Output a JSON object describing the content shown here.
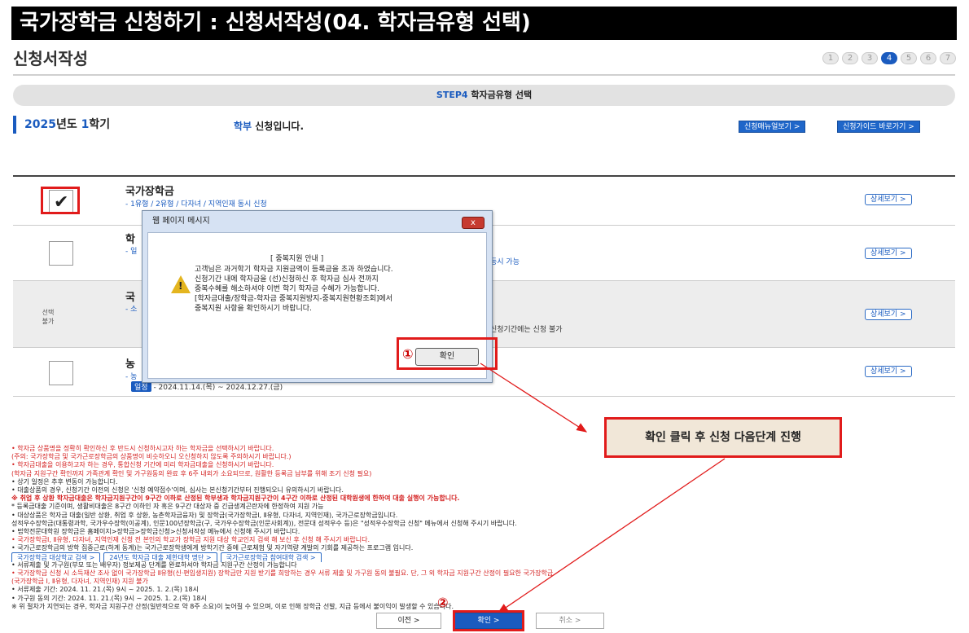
{
  "banner": "국가장학금 신청하기 : 신청서작성(04. 학자금유형 선택)",
  "page_title": "신청서작성",
  "steps": [
    "1",
    "2",
    "3",
    "4",
    "5",
    "6",
    "7"
  ],
  "active_step": "4",
  "step_bar": {
    "step": "STEP4",
    "label": "학자금유형 선택"
  },
  "semester": {
    "year": "2025",
    "year_suffix": "년도 ",
    "term": "1",
    "term_suffix": "학기"
  },
  "apply_status": {
    "level": "학부",
    "text": " 신청입니다."
  },
  "top_buttons": {
    "manual": "신청매뉴얼보기 >",
    "guide": "신청가이드 바로가기 >"
  },
  "rows": [
    {
      "title": "국가장학금",
      "sub": "- 1유형 / 2유형 / 다자녀 / 지역인재 동시 신청",
      "checked": true,
      "detail": "상세보기 >"
    },
    {
      "title": "학",
      "sub": "- 일",
      "extra": "등시 가능",
      "checked": false,
      "detail": "상세보기 >"
    },
    {
      "title": "국",
      "sub": "- 소",
      "extra": "신청기간에는 신청 불가",
      "nosel": "선택\n불가",
      "detail": "상세보기 >"
    },
    {
      "title": "농",
      "sub": "- 농",
      "schedule_tag": "일정",
      "schedule": "- 2024.11.14.(목) ~ 2024.12.27.(금)",
      "checked": false,
      "detail": "상세보기 >"
    }
  ],
  "dialog": {
    "title": "웹 페이지 메시지",
    "close": "x",
    "lines": [
      "[ 중복지원 안내 ]",
      "고객님은 과거학기 학자금 지원금액이 등록금을 초과 하였습니다.",
      "신청기간 내에 학자금을 (선)신청하신 후 학자금 심사 전까지",
      "중복수혜를 해소하셔야 이번 학기 학자금 수혜가 가능합니다.",
      "[학자금대출/장학금-학자금 중복지원방지-중복지원현황조회]에서",
      "중복지원 사항을 확인하시기 바랍니다."
    ],
    "ok": "확인"
  },
  "markers": {
    "one": "①",
    "two": "②"
  },
  "callout": "확인 클릭 후 신청 다음단계 진행",
  "notes": [
    {
      "t": "• 학자금 상품명을 정확히 확인하신 후 반드시 신청하시고자 하는 학자금을 선택하시기 바랍니다.",
      "c": "red"
    },
    {
      "t": "(주의: 국가장학금 및 국가근로장학금의 상품명이 비슷하오니 오신청하지 않도록 주의하시기 바랍니다.)",
      "c": "red"
    },
    {
      "t": "• 학자금대출을 이용하고자 하는 경우, 통합신청 기간에 미리 학자금대출을 신청하시기 바랍니다.",
      "c": "red"
    },
    {
      "t": "(학자금 지원구간 확인까지 가족관계 확인 및 가구원동의 완료 후 6주 내외가 소요되므로, 원활한 등록금 납부를 위해 조기 신청 필요)",
      "c": "red"
    },
    {
      "t": "• 상기 일정은 추후 변동이 가능합니다.",
      "c": ""
    },
    {
      "t": "• 대출상품의 경우, 신청기간 이전의 신청은 '신청 예약접수'이며, 심사는 본신청기간부터 진행되오니 유의하시기 바랍니다.",
      "c": ""
    },
    {
      "t": "※ 취업 후 상환 학자금대출은 학자금지원구간이 9구간 이하로 산정된 학부생과 학자금지원구간이 4구간 이하로 산정된 대학원생에 한하여 대출 실행이 가능합니다.",
      "c": "red bold"
    },
    {
      "t": "* 등록금대출 기준이며, 생활비대출은 8구간 이하인 자 혹은 9구간 대상자 중 긴급생계곤란자에 한정하여 지원 가능",
      "c": ""
    },
    {
      "t": "• 대상상품은 학자금 대출(일반 상환, 취업 후 상환, 농촌학자금융자) 및 장학금(국가장학금Ⅰ, Ⅱ유형, 다자녀, 지역인재), 국가근로장학금입니다.",
      "c": ""
    },
    {
      "t": "성적우수장학금(대통령과학, 국가우수장학(이공계), 인문100년장학금(구, 국가우수장학금(인문사회계)), 전문대 성적우수 등)은 \"성적우수장학금 신청\" 메뉴에서 신청해 주시기 바랍니다.",
      "c": ""
    },
    {
      "t": "• 법학전문대학원 장학금은 홈페이지>장학금>장학금신청>신청서작성 메뉴에서 신청해 주시기 바랍니다.",
      "c": ""
    },
    {
      "t": "• 국가장학금Ⅰ, Ⅱ유형, 다자녀, 지역인재 신청 전 본인의 학교가 장학금 지원 대상 학교인지 검색 해 보신 후 신청 해 주시기 바랍니다.",
      "c": "red"
    },
    {
      "t": "• 국가근로장학금의 방학 집중근로(하계 동계)는 국가근로장학생에게 방학기간 중에 근로체험 및 자기역량 계발의 기회를 제공하는 프로그램 입니다.",
      "c": ""
    },
    {
      "t": "BUTTONS",
      "c": ""
    },
    {
      "t": "• 서류제출 및 가구원(부모 또는 배우자) 정보제공 단계를 완료하셔야 학자금 지원구간 산정이 가능합니다",
      "c": ""
    },
    {
      "t": "• 국가장학금 신청 시 소득재산 조사 없이 국가장학금 Ⅱ유형(신·편입생지원) 장학금만 지원 받기를 희망하는 경우 서류 제출 및 가구원 동의 불필요. 단, 그 외 학자금 지원구간 산정이 필요한 국가장학금",
      "c": "red"
    },
    {
      "t": "(국가장학금 Ⅰ, Ⅱ유형, 다자녀, 지역인재) 지원 불가",
      "c": "red"
    },
    {
      "t": "• 서류제출 기간: 2024. 11. 21.(목) 9시 ~ 2025. 1. 2.(목) 18시",
      "c": ""
    },
    {
      "t": "• 가구원 동의 기간: 2024. 11. 21.(목) 9시 ~ 2025. 1. 2.(목) 18시",
      "c": ""
    },
    {
      "t": "※ 위 절차가 지연되는 경우, 학자금 지원구간 산정(일반적으로 약 8주 소요)이 늦어질 수 있으며, 이로 인해 장학금 선발, 지급 등에서 불이익이 발생할 수 있습니다.",
      "c": ""
    }
  ],
  "note_buttons": [
    "국가장학금 대상학교 검색 >",
    "24년도 학자금 대출 제한대학 명단 >",
    "국가근로장학금 참여대학 검색 >"
  ],
  "bottom_buttons": {
    "prev": "이전 >",
    "confirm": "확인 >",
    "cancel": "취소 >"
  }
}
